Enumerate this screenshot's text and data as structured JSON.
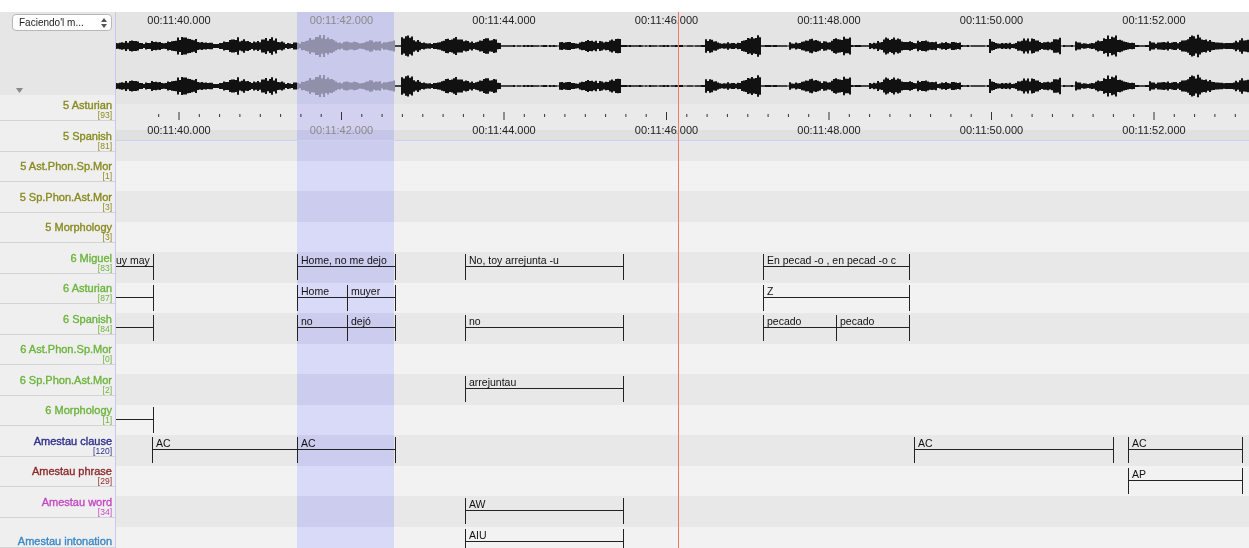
{
  "tier_selector": {
    "value": "Faciendo'l m..."
  },
  "waveform": {
    "time_labels": [
      "00:11:40.000",
      "00:11:42.000",
      "00:11:44.000",
      "00:11:46.000",
      "00:11:48.000",
      "00:11:50.000",
      "00:11:52.000"
    ]
  },
  "ruler": {
    "time_labels": [
      "00:11:40.000",
      "00:11:42.000",
      "00:11:44.000",
      "00:11:46.000",
      "00:11:48.000",
      "00:11:50.000",
      "00:11:52.000"
    ]
  },
  "tiers": [
    {
      "name": "5 Asturian",
      "count": "[93]",
      "color": "#8a8a20"
    },
    {
      "name": "5 Spanish",
      "count": "[81]",
      "color": "#8a8a20"
    },
    {
      "name": "5 Ast.Phon.Sp.Mor",
      "count": "[1]",
      "color": "#8a8a20"
    },
    {
      "name": "5 Sp.Phon.Ast.Mor",
      "count": "[3]",
      "color": "#8a8a20"
    },
    {
      "name": "5 Morphology",
      "count": "[3]",
      "color": "#8a8a20"
    },
    {
      "name": "6 Miguel",
      "count": "[83]",
      "color": "#6cb43c",
      "annotations": [
        {
          "kind": "continued",
          "text": "uy may"
        },
        {
          "kind": "full",
          "text": "Home, no me dejo"
        },
        {
          "kind": "full",
          "text": "No, toy arrejunta -u"
        },
        {
          "kind": "full",
          "text": "En pecad -o , en pecad -o c"
        }
      ]
    },
    {
      "name": "6 Asturian",
      "count": "[87]",
      "color": "#6cb43c",
      "annotations": [
        {
          "kind": "continued"
        },
        {
          "kind": "full",
          "text": "Home"
        },
        {
          "kind": "full",
          "text": "muyer"
        },
        {
          "kind": "full",
          "text": "Z"
        }
      ]
    },
    {
      "name": "6 Spanish",
      "count": "[84]",
      "color": "#6cb43c",
      "annotations": [
        {
          "kind": "continued"
        },
        {
          "kind": "full",
          "text": "no"
        },
        {
          "kind": "full",
          "text": "dejó"
        },
        {
          "kind": "full",
          "text": "no"
        },
        {
          "kind": "full",
          "text": "pecado"
        },
        {
          "kind": "full",
          "text": "pecado"
        }
      ]
    },
    {
      "name": "6 Ast.Phon.Sp.Mor",
      "count": "[0]",
      "color": "#6cb43c"
    },
    {
      "name": "6 Sp.Phon.Ast.Mor",
      "count": "[2]",
      "color": "#6cb43c",
      "annotations": [
        {
          "kind": "full",
          "text": "arrejuntau"
        }
      ]
    },
    {
      "name": "6 Morphology",
      "count": "[1]",
      "color": "#6cb43c",
      "annotations": [
        {
          "kind": "continued"
        }
      ]
    },
    {
      "name": "Amestau clause",
      "count": "[120]",
      "color": "#2e2e8c",
      "annotations": [
        {
          "kind": "full",
          "text": "AC"
        },
        {
          "kind": "full",
          "text": "AC"
        },
        {
          "kind": "full",
          "text": "AC"
        },
        {
          "kind": "full",
          "text": "AC"
        }
      ]
    },
    {
      "name": "Amestau phrase",
      "count": "[29]",
      "color": "#8c2a2a",
      "annotations": [
        {
          "kind": "full",
          "text": "AP"
        }
      ]
    },
    {
      "name": "Amestau word",
      "count": "[34]",
      "color": "#c447c4",
      "annotations": [
        {
          "kind": "full",
          "text": "AW"
        }
      ]
    },
    {
      "name": "Amestau intonation",
      "color": "#3a88c8",
      "annotations": [
        {
          "kind": "full",
          "text": "AIU"
        }
      ]
    }
  ]
}
